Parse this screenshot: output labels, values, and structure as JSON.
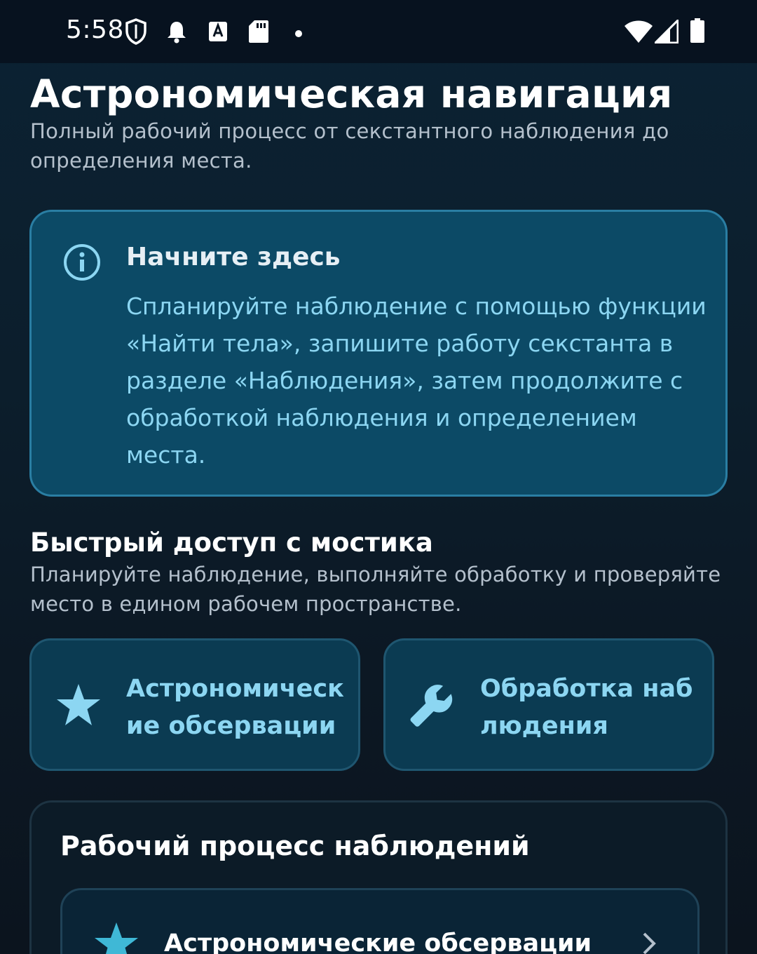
{
  "status_bar": {
    "time": "5:58"
  },
  "header": {
    "title": "Астрономическая навигация",
    "subtitle": "Полный рабочий процесс от секстантного наблюдения до определения места."
  },
  "info_card": {
    "icon": "info-icon",
    "title": "Начните здесь",
    "body": "Спланируйте наблюдение с помощью функции «Найти тела», запишите работу секстанта в разделе «Наблюдения», затем продолжите с обработкой наблюдения и определением места."
  },
  "quick_access": {
    "title": "Быстрый доступ с мостика",
    "subtitle": "Планируйте наблюдение, выполняйте обработку и проверяйте место в едином рабочем пространстве.",
    "buttons": [
      {
        "label": "Астрономические обсервации",
        "icon": "star-icon"
      },
      {
        "label": "Обработка наблюдения",
        "icon": "wrench-icon"
      }
    ]
  },
  "workflow": {
    "title": "Рабочий процесс наблюдений",
    "items": [
      {
        "label": "Астрономические обсервации",
        "icon": "star-icon"
      }
    ]
  },
  "colors": {
    "accent": "#8cd6f2",
    "info_card_bg": "#0c4a66",
    "info_card_border": "#2a7ea3",
    "star_accent": "#3fb8d6"
  }
}
